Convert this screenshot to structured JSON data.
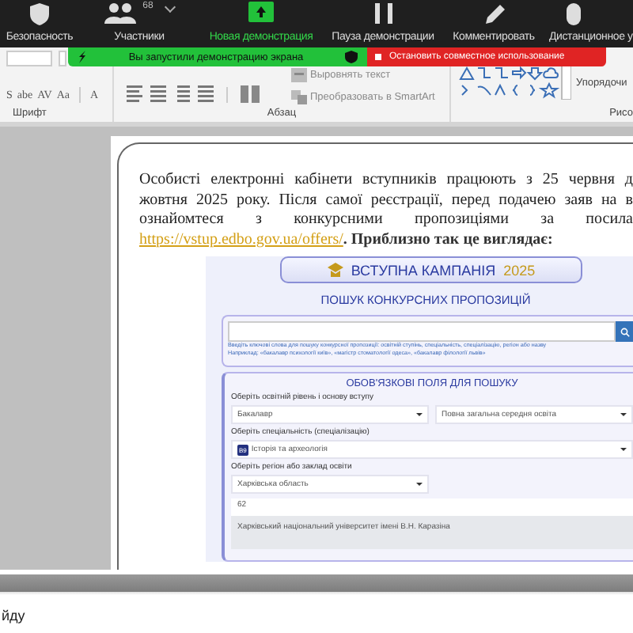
{
  "zoom_toolbar": {
    "items": [
      {
        "kind": "security",
        "label": "Безопасность"
      },
      {
        "kind": "participants",
        "label": "Участники",
        "count": "68"
      },
      {
        "kind": "share",
        "label": "Новая демонстрация"
      },
      {
        "kind": "pause",
        "label": "Пауза демонстрации"
      },
      {
        "kind": "annotate",
        "label": "Комментировать"
      },
      {
        "kind": "remote",
        "label": "Дистанционное у"
      }
    ]
  },
  "share_banner": {
    "status": "Вы запустили демонстрацию экрана",
    "stop": "Остановить совместное использование"
  },
  "ribbon": {
    "font_buttons": [
      "S",
      "abe",
      "AV",
      "Aa",
      "A"
    ],
    "align_text": "Выровнять текст",
    "smartart": "Преобразовать в SmartArt",
    "arrange": "Упорядочи",
    "groups": [
      "Шрифт",
      "Абзац",
      "Рисо"
    ]
  },
  "document": {
    "lines": [
      "Особисті електронні кабінети вступників працюють з 25 червня д",
      "жовтня 2025 року. Після самої реєстрації, перед подачею заяв на в",
      "ознайомтеся з конкурсними пропозиціями за посила"
    ],
    "link": "https://vstup.edbo.gov.ua/offers/",
    "after_link": ". Приблизно так це виглядає:",
    "embedded": {
      "campaign_title": "ВСТУПНА КАМПАНІЯ",
      "campaign_year": "2025",
      "search_title": "ПОШУК КОНКУРСНИХ ПРОПОЗИЦІЙ",
      "search_hint": [
        "Введіть ключові слова для пошуку конкурсної пропозиції: освітній ступінь, спеціальність, спеціалізацію, регіон або назву",
        "Наприклад: «бакалавр психології київ», «магістр стоматології одеса», «бакалавр філології львів»"
      ],
      "required_title": "ОБОВ'ЯЗКОВІ ПОЛЯ ДЛЯ ПОШУКУ",
      "rows": [
        {
          "kind": "label",
          "text": "Оберіть освітній рівень і основу вступу"
        },
        {
          "kind": "selects",
          "values": [
            "Бакалавр",
            "Повна загальна середня освіта"
          ]
        },
        {
          "kind": "label",
          "text": "Оберіть спеціальність (спеціалізацію)"
        },
        {
          "kind": "specialty",
          "code": "B9",
          "value": "Історія та археологія"
        },
        {
          "kind": "label",
          "text": "Оберіть регіон або заклад освіти"
        },
        {
          "kind": "selects",
          "values": [
            "Харківська область"
          ]
        },
        {
          "kind": "input",
          "value": "62"
        },
        {
          "kind": "result",
          "text": "Харківський національний університет імені В.Н. Каразіна"
        }
      ]
    }
  },
  "footer_text": "йду"
}
